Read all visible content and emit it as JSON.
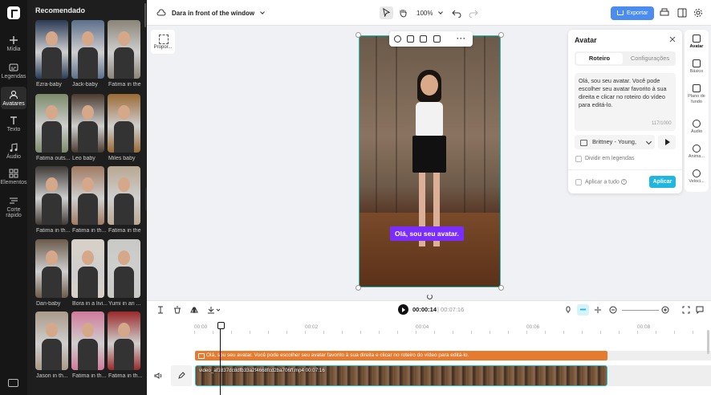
{
  "rail": {
    "items": [
      {
        "label": "Mídia",
        "icon": "plus-icon"
      },
      {
        "label": "Legendas",
        "icon": "captions-icon"
      },
      {
        "label": "Avatares",
        "icon": "avatar-icon"
      },
      {
        "label": "Texto",
        "icon": "text-icon"
      },
      {
        "label": "Áudio",
        "icon": "music-icon"
      },
      {
        "label": "Elementos",
        "icon": "elements-icon"
      },
      {
        "label": "Corte rápido",
        "icon": "cut-icon"
      }
    ],
    "active_index": 2
  },
  "library": {
    "title": "Recomendado",
    "avatars": [
      {
        "label": "Ezra-baby",
        "color": "#2b3a55"
      },
      {
        "label": "Jack-baby",
        "color": "#5c6f8a"
      },
      {
        "label": "Fatima in the",
        "color": "#8a8478"
      },
      {
        "label": "Fatima outs...",
        "color": "#7c8a6a"
      },
      {
        "label": "Leo baby",
        "color": "#4a3a2e"
      },
      {
        "label": "Miles baby",
        "color": "#9a6a34"
      },
      {
        "label": "Fatima in th...",
        "color": "#3e3a36"
      },
      {
        "label": "Fatima in th...",
        "color": "#a07a62"
      },
      {
        "label": "Fatima in the",
        "color": "#b8a892"
      },
      {
        "label": "Dan-baby",
        "color": "#6a5a4a"
      },
      {
        "label": "Bora in a livi...",
        "color": "#d8d0c6"
      },
      {
        "label": "Yumi in an ...",
        "color": "#c8c8c4"
      },
      {
        "label": "Jason in th...",
        "color": "#aa9a88"
      },
      {
        "label": "Fatima in th...",
        "color": "#d07a9a"
      },
      {
        "label": "Fatima in th...",
        "color": "#9a2a2a"
      }
    ]
  },
  "topbar": {
    "project_title": "Dara in front of the window",
    "zoom": "100%",
    "export_label": "Exportar"
  },
  "canvas": {
    "ratio_label": "Propor...",
    "caption": "Olá, sou seu avatar."
  },
  "avatar_panel": {
    "title": "Avatar",
    "tab_script": "Roteiro",
    "tab_settings": "Configurações",
    "script_text": "Olá, sou seu avatar. Você pode escolher seu avatar favorito à sua direita e clicar no roteiro do vídeo para editá-lo.",
    "char_count": "117/1000",
    "voice": "Brittney - Young,",
    "split_label": "Dividir em legendas",
    "apply_all_label": "Aplicar a tudo",
    "apply_button": "Aplicar"
  },
  "right_sidebar": {
    "items": [
      {
        "label": "Avatar",
        "icon": "avatar-icon"
      },
      {
        "label": "Básico",
        "icon": "basic-icon"
      },
      {
        "label": "Plano de fundo",
        "icon": "background-icon"
      },
      {
        "label": "Áudio",
        "icon": "audio-icon"
      },
      {
        "label": "Anima...",
        "icon": "animation-icon"
      },
      {
        "label": "Veloci...",
        "icon": "speed-icon"
      }
    ]
  },
  "timeline": {
    "current_time": "00:00:14",
    "total_time": "00:07:16",
    "ruler": [
      "00:00",
      "00:02",
      "00:04",
      "00:06",
      "00:08"
    ],
    "text_track": "Olá, sou seu avatar. Você pode escolher seu avatar favorito à sua direita e clicar no roteiro do vídeo para editá-lo.",
    "video_track": "video_af1837dc8dfb33a2f4668fcd2ba706ff.mp4   00:07:16"
  }
}
